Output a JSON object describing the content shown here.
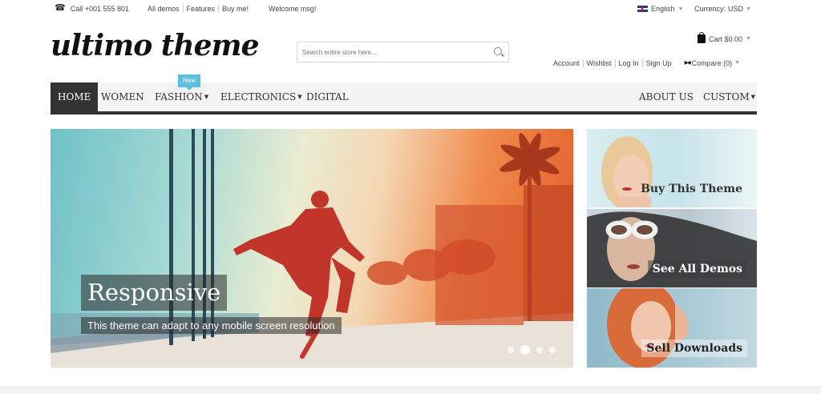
{
  "topbar": {
    "phone": "Call +001 555 801",
    "links": [
      "All demos",
      "Features",
      "Buy me!"
    ],
    "welcome": "Welcome msg!",
    "language": "English",
    "currency_label": "Currency:",
    "currency": "USD"
  },
  "header": {
    "logo": "ultimo theme",
    "search_placeholder": "Search entire store here...",
    "cart": "Cart $0.00",
    "account_links": [
      "Account",
      "Wishlist",
      "Log In",
      "Sign Up"
    ],
    "compare": "Compare (0)"
  },
  "nav": {
    "items": [
      "HOME",
      "WOMEN",
      "FASHION",
      "ELECTRONICS",
      "DIGITAL"
    ],
    "right_items": [
      "ABOUT US",
      "CUSTOM"
    ],
    "badge": "New"
  },
  "hero": {
    "title": "Responsive",
    "subtitle": "This theme can adapt to any mobile screen resolution",
    "slide_count": 4,
    "active_slide": 2
  },
  "side_banners": [
    {
      "label": "Buy This Theme"
    },
    {
      "label": "See All Demos"
    },
    {
      "label": "Sell Downloads"
    }
  ],
  "colors": {
    "nav_active": "#333333",
    "badge": "#5bc0de"
  }
}
